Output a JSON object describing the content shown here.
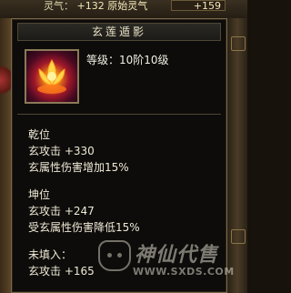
{
  "background": {
    "stat_row_label": "灵气：",
    "stat_row_value": "+132 原始灵气",
    "stat_row_box": "+159",
    "colors": {
      "frame": "#7a6a4a",
      "bg": "#0d0c0a"
    }
  },
  "tooltip": {
    "title": "玄莲遁影",
    "level": "等级：10阶10级",
    "icon": "lotus-icon",
    "sections": [
      {
        "heading": "乾位",
        "lines": [
          "玄攻击 +330",
          "玄属性伤害增加15%"
        ]
      },
      {
        "heading": "坤位",
        "lines": [
          "玄攻击 +247",
          "受玄属性伤害降低15%"
        ]
      },
      {
        "heading": "未填入：",
        "lines": [
          "玄攻击 +165"
        ]
      }
    ]
  },
  "watermark": {
    "brand": "神仙代售",
    "url": "WWW.SXDS.COM"
  }
}
